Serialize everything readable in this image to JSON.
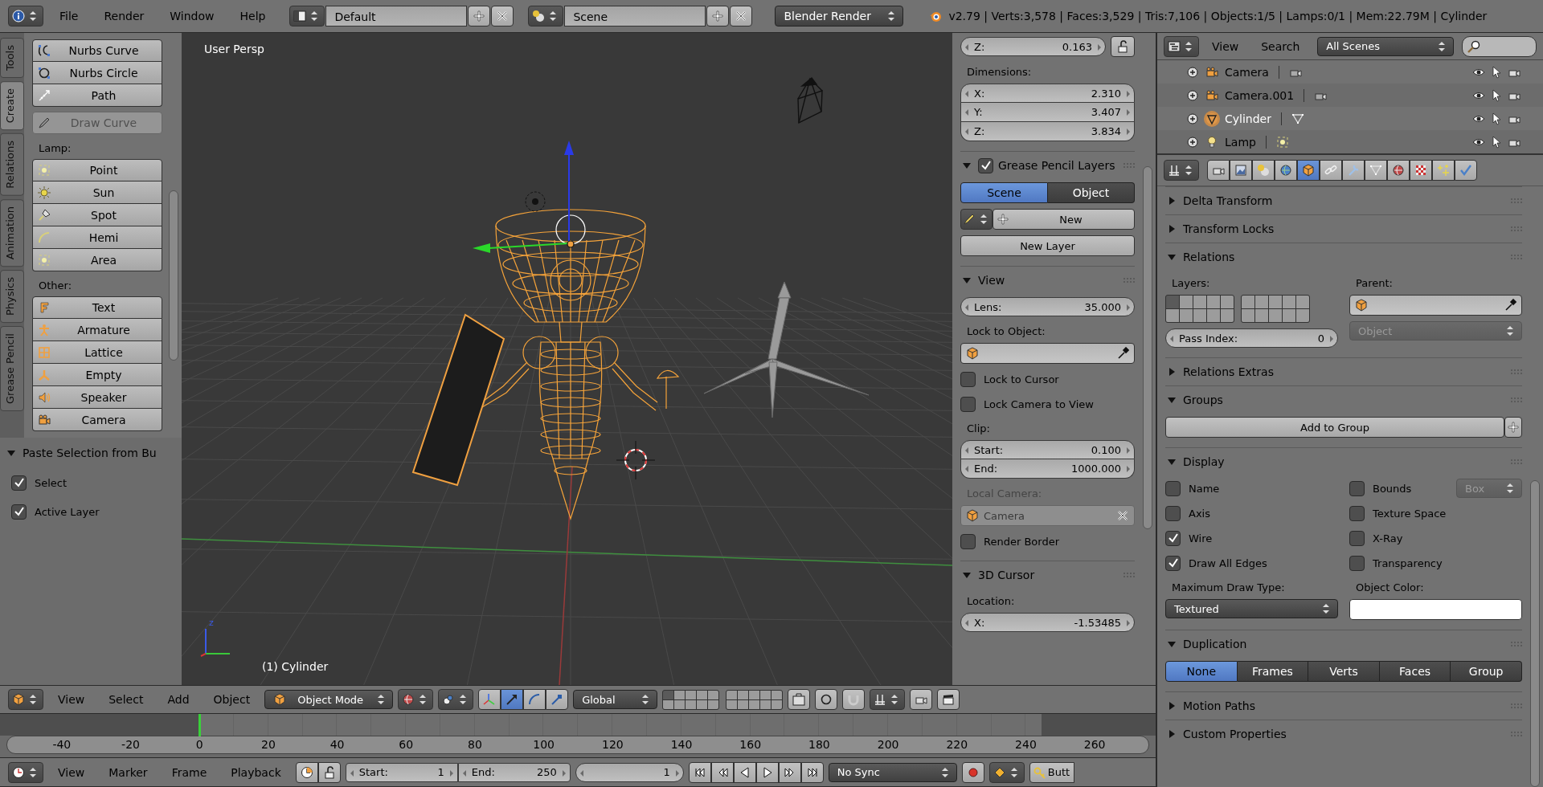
{
  "top_bar": {
    "menus": [
      "File",
      "Render",
      "Window",
      "Help"
    ],
    "screen_layout": "Default",
    "scene": "Scene",
    "render_engine": "Blender Render",
    "stats": "v2.79 | Verts:3,578 | Faces:3,529 | Tris:7,106 | Objects:1/5 | Lamps:0/1 | Mem:22.79M | Cylinder"
  },
  "tool_shelf": {
    "tabs": [
      {
        "label": "Tools",
        "selected": false
      },
      {
        "label": "Create",
        "selected": true
      },
      {
        "label": "Relations",
        "selected": false
      },
      {
        "label": "Animation",
        "selected": false
      },
      {
        "label": "Physics",
        "selected": false
      },
      {
        "label": "Grease Pencil",
        "selected": false
      }
    ],
    "groups": [
      {
        "buttons": [
          {
            "label": "Nurbs Curve",
            "disabled": false
          },
          {
            "label": "Nurbs Circle",
            "disabled": false
          },
          {
            "label": "Path",
            "disabled": false
          }
        ]
      },
      {
        "buttons": [
          {
            "label": "Draw Curve",
            "disabled": true
          }
        ]
      },
      {
        "heading": "Lamp:",
        "buttons": [
          {
            "label": "Point",
            "disabled": false
          },
          {
            "label": "Sun",
            "disabled": false
          },
          {
            "label": "Spot",
            "disabled": false
          },
          {
            "label": "Hemi",
            "disabled": false
          },
          {
            "label": "Area",
            "disabled": false
          }
        ]
      },
      {
        "heading": "Other:",
        "buttons": [
          {
            "label": "Text",
            "disabled": false
          },
          {
            "label": "Armature",
            "disabled": false
          },
          {
            "label": "Lattice",
            "disabled": false
          },
          {
            "label": "Empty",
            "disabled": false
          },
          {
            "label": "Speaker",
            "disabled": false
          },
          {
            "label": "Camera",
            "disabled": false
          }
        ]
      }
    ]
  },
  "operator_panel": {
    "title": "Paste Selection from Bu",
    "expanded": true,
    "options": [
      {
        "label": "Select",
        "checked": true
      },
      {
        "label": "Active Layer",
        "checked": true
      }
    ]
  },
  "viewport": {
    "view_name": "User Persp",
    "object_info": "(1) Cylinder",
    "axis_label": "z"
  },
  "view_properties": {
    "sections": [
      {
        "rows": [
          {
            "kind": "number",
            "label": "Z:",
            "value": "0.163",
            "locked": false
          },
          {
            "kind": "label",
            "text": "Dimensions:"
          },
          {
            "kind": "number_stack",
            "fields": [
              {
                "label": "X:",
                "value": "2.310"
              },
              {
                "label": "Y:",
                "value": "3.407"
              },
              {
                "label": "Z:",
                "value": "3.834"
              }
            ]
          }
        ]
      },
      {
        "title": "Grease Pencil Layers",
        "checked": true,
        "expanded": true,
        "rows": [
          {
            "kind": "segmented",
            "options": [
              {
                "label": "Scene",
                "selected": true
              },
              {
                "label": "Object",
                "selected": false
              }
            ]
          },
          {
            "kind": "new_datablock",
            "label": "New"
          },
          {
            "kind": "button",
            "label": "New Layer"
          }
        ]
      },
      {
        "title": "View",
        "expanded": true,
        "rows": [
          {
            "kind": "number",
            "label": "Lens:",
            "value": "35.000"
          },
          {
            "kind": "label",
            "text": "Lock to Object:"
          },
          {
            "kind": "object_picker",
            "disabled": false
          },
          {
            "kind": "checkbox",
            "label": "Lock to Cursor",
            "checked": false
          },
          {
            "kind": "checkbox",
            "label": "Lock Camera to View",
            "checked": false
          },
          {
            "kind": "label",
            "text": "Clip:"
          },
          {
            "kind": "number_stack",
            "fields": [
              {
                "label": "Start:",
                "value": "0.100"
              },
              {
                "label": "End:",
                "value": "1000.000"
              }
            ]
          },
          {
            "kind": "label",
            "text": "Local Camera:",
            "disabled": true
          },
          {
            "kind": "object_field",
            "value": "Camera",
            "disabled": true
          },
          {
            "kind": "checkbox",
            "label": "Render Border",
            "checked": false
          }
        ]
      },
      {
        "title": "3D Cursor",
        "expanded": true,
        "rows": [
          {
            "kind": "label",
            "text": "Location:"
          },
          {
            "kind": "number_stack",
            "fields": [
              {
                "label": "X:",
                "value": "-1.53485"
              }
            ]
          }
        ]
      }
    ]
  },
  "viewport_header": {
    "menus": [
      "View",
      "Select",
      "Add",
      "Object"
    ],
    "mode": "Object Mode",
    "manipulators": [
      {
        "selected": false
      },
      {
        "selected": true
      },
      {
        "selected": false
      },
      {
        "selected": false
      }
    ],
    "orientation": "Global",
    "layers": [
      {
        "selected": true
      },
      {
        "selected": false
      },
      {
        "selected": false
      },
      {
        "selected": false
      },
      {
        "selected": false
      },
      {
        "selected": false
      },
      {
        "selected": false
      },
      {
        "selected": false
      },
      {
        "selected": false
      },
      {
        "selected": false
      },
      {
        "selected": false
      },
      {
        "selected": false
      },
      {
        "selected": false
      },
      {
        "selected": false
      },
      {
        "selected": false
      },
      {
        "selected": false
      },
      {
        "selected": false
      },
      {
        "selected": false
      },
      {
        "selected": false
      },
      {
        "selected": false
      }
    ]
  },
  "timeline": {
    "ticks": [
      "-40",
      "-20",
      "0",
      "20",
      "40",
      "60",
      "80",
      "100",
      "120",
      "140",
      "160",
      "180",
      "200",
      "220",
      "240",
      "260"
    ]
  },
  "timeline_header": {
    "menus": [
      "View",
      "Marker",
      "Frame",
      "Playback"
    ],
    "start": {
      "label": "Start:",
      "value": "1"
    },
    "end": {
      "label": "End:",
      "value": "250"
    },
    "current_frame": "1",
    "sync": "No Sync",
    "keying_button": "Butt"
  },
  "outliner": {
    "menus": [
      "View",
      "Search"
    ],
    "filter": "All Scenes",
    "items": [
      {
        "name": "Camera",
        "selected": false
      },
      {
        "name": "Camera.001",
        "selected": false
      },
      {
        "name": "Cylinder",
        "selected": true
      },
      {
        "name": "Lamp",
        "selected": false
      }
    ]
  },
  "properties": {
    "tabs": [
      {
        "selected": false
      },
      {
        "selected": false
      },
      {
        "selected": false
      },
      {
        "selected": false
      },
      {
        "selected": true
      },
      {
        "selected": false
      },
      {
        "selected": false
      },
      {
        "selected": false
      },
      {
        "selected": false
      },
      {
        "selected": false
      },
      {
        "selected": false
      },
      {
        "selected": false
      }
    ],
    "sections": [
      {
        "title": "Delta Transform",
        "expanded": false
      },
      {
        "title": "Transform Locks",
        "expanded": false
      },
      {
        "title": "Relations",
        "expanded": true,
        "rows": [
          {
            "kind": "columns",
            "columns": [
              [
                {
                  "kind": "label",
                  "text": "Layers:"
                },
                {
                  "kind": "layers",
                  "layers": [
                    {
                      "selected": true
                    },
                    {
                      "selected": false
                    },
                    {
                      "selected": false
                    },
                    {
                      "selected": false
                    },
                    {
                      "selected": false
                    },
                    {
                      "selected": false
                    },
                    {
                      "selected": false
                    },
                    {
                      "selected": false
                    },
                    {
                      "selected": false
                    },
                    {
                      "selected": false
                    },
                    {
                      "selected": false
                    },
                    {
                      "selected": false
                    },
                    {
                      "selected": false
                    },
                    {
                      "selected": false
                    },
                    {
                      "selected": false
                    },
                    {
                      "selected": false
                    },
                    {
                      "selected": false
                    },
                    {
                      "selected": false
                    },
                    {
                      "selected": false
                    },
                    {
                      "selected": false
                    }
                  ]
                },
                {
                  "kind": "number",
                  "label": "Pass Index:",
                  "value": "0"
                }
              ],
              [
                {
                  "kind": "label",
                  "text": "Parent:"
                },
                {
                  "kind": "object_picker",
                  "disabled": false
                },
                {
                  "kind": "dropdown",
                  "value": "Object",
                  "disabled": true
                }
              ]
            ]
          }
        ]
      },
      {
        "title": "Relations Extras",
        "expanded": false
      },
      {
        "title": "Groups",
        "expanded": true,
        "rows": [
          {
            "kind": "add_button",
            "label": "Add to Group"
          }
        ]
      },
      {
        "title": "Display",
        "expanded": true,
        "rows": [
          {
            "kind": "columns",
            "columns": [
              [
                {
                  "kind": "checkbox",
                  "label": "Name",
                  "checked": false
                },
                {
                  "kind": "checkbox",
                  "label": "Axis",
                  "checked": false
                },
                {
                  "kind": "checkbox",
                  "label": "Wire",
                  "checked": true
                },
                {
                  "kind": "checkbox",
                  "label": "Draw All Edges",
                  "checked": true
                },
                {
                  "kind": "label",
                  "text": "Maximum Draw Type:"
                },
                {
                  "kind": "dropdown",
                  "value": "Textured",
                  "disabled": false
                }
              ],
              [
                {
                  "kind": "checkbox",
                  "label": "Bounds",
                  "checked": false,
                  "dropdown": {
                    "value": "Box",
                    "disabled": true
                  }
                },
                {
                  "kind": "checkbox",
                  "label": "Texture Space",
                  "checked": false
                },
                {
                  "kind": "checkbox",
                  "label": "X-Ray",
                  "checked": false
                },
                {
                  "kind": "checkbox",
                  "label": "Transparency",
                  "checked": false
                },
                {
                  "kind": "label",
                  "text": "Object Color:"
                },
                {
                  "kind": "color_field",
                  "color": "#ffffff"
                }
              ]
            ]
          }
        ]
      },
      {
        "title": "Duplication",
        "expanded": true,
        "rows": [
          {
            "kind": "segmented",
            "options": [
              {
                "label": "None",
                "selected": true
              },
              {
                "label": "Frames",
                "selected": false
              },
              {
                "label": "Verts",
                "selected": false
              },
              {
                "label": "Faces",
                "selected": false
              },
              {
                "label": "Group",
                "selected": false
              }
            ]
          }
        ]
      },
      {
        "title": "Motion Paths",
        "expanded": false
      },
      {
        "title": "Custom Properties",
        "expanded": false
      }
    ]
  }
}
